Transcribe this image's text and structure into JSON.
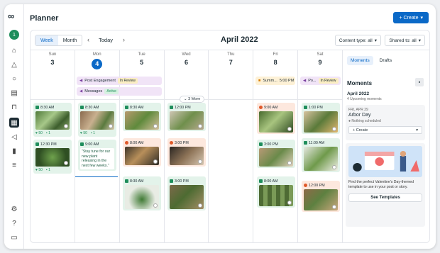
{
  "app": {
    "title": "Planner"
  },
  "toolbar": {
    "create_label": "+ Create",
    "views": [
      "Week",
      "Month"
    ],
    "active_view": "Week",
    "prev_symbol": "‹",
    "next_symbol": "›",
    "today_label": "Today",
    "month_label": "April 2022",
    "content_type_filter": "Content type: all",
    "shared_to_filter": "Shared to: all"
  },
  "days": [
    {
      "name": "Sun",
      "num": "3"
    },
    {
      "name": "Mon",
      "num": "4",
      "selected": true
    },
    {
      "name": "Tue",
      "num": "5"
    },
    {
      "name": "Wed",
      "num": "6"
    },
    {
      "name": "Thu",
      "num": "7"
    },
    {
      "name": "Fri",
      "num": "8"
    },
    {
      "name": "Sat",
      "num": "9"
    }
  ],
  "allday_events": [
    {
      "label": "Post Engagement",
      "status": "In Review"
    },
    {
      "label": "Messages",
      "status": "Active"
    },
    {
      "label": "Summ...",
      "time": "5:00 PM"
    },
    {
      "label": "Po...",
      "status": "In Review"
    }
  ],
  "more_label": "3 More",
  "posts": {
    "sun": [
      {
        "time": "8:30 AM",
        "likes": "50",
        "comments": "1"
      },
      {
        "time": "12:30 PM",
        "likes": "50",
        "comments": "1"
      }
    ],
    "mon": [
      {
        "time": "8:30 AM",
        "likes": "50",
        "comments": "1"
      },
      {
        "time": "9:00 AM",
        "note": "\"Stay tune for our new plant releasing in the next few weeks.\""
      }
    ],
    "tue": [
      {
        "time": "8:30 AM"
      },
      {
        "time": "8:00 AM"
      },
      {
        "time": "8:30 AM"
      }
    ],
    "wed": [
      {
        "time": "12:00 PM"
      },
      {
        "time": "3:00 PM"
      },
      {
        "time": "3:00 PM"
      }
    ],
    "fri": [
      {
        "time": "9:00 AM"
      },
      {
        "time": "3:00 PM"
      },
      {
        "time": "8:00 AM"
      }
    ],
    "sat": [
      {
        "time": "1:00 PM"
      },
      {
        "time": "11:00 AM"
      },
      {
        "time": "12:00 PM"
      }
    ]
  },
  "sidebar": {
    "tabs": [
      "Moments",
      "Drafts"
    ],
    "active_tab": "Moments",
    "heading": "Moments",
    "month": "April 2022",
    "count": "4 Upcoming moments",
    "moment": {
      "date": "FRI, APR 29",
      "name": "Arbor Day",
      "status": "Nothing scheduled",
      "create_label": "+ Create"
    },
    "promo_text": "Find the perfect Valentine's Day-themed template to use in your post or story.",
    "promo_button": "See Templates"
  },
  "colors": {
    "accent": "#0b69c7",
    "green": "#1f8e5c",
    "orange": "#e0592a"
  }
}
